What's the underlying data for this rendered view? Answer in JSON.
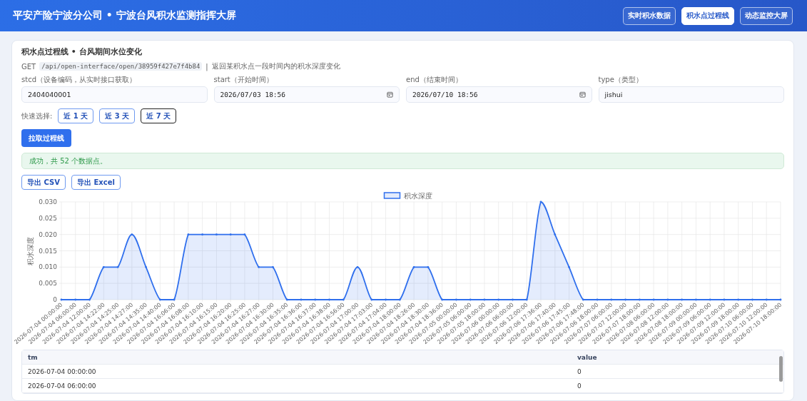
{
  "header": {
    "title": "平安产险宁波分公司 • 宁波台风积水监测指挥大屏",
    "nav": [
      {
        "label": "实时积水数据",
        "selected": false
      },
      {
        "label": "积水点过程线",
        "selected": true
      },
      {
        "label": "动态监控大屏",
        "selected": false
      }
    ]
  },
  "panel": {
    "title": "积水点过程线 • 台风期间水位变化",
    "api": {
      "method": "GET",
      "path": "/api/open-interface/open/38959f427e7f4b84",
      "separator": "|",
      "description": "返回某积水点一段时间内的积水深度变化"
    },
    "fields": [
      {
        "kind": "text",
        "label": "stcd（设备编码，从实时接口获取）",
        "value": "2404040001"
      },
      {
        "kind": "datetime",
        "label": "start（开始时间）",
        "value": "2026/07/03 18:56"
      },
      {
        "kind": "datetime",
        "label": "end（结束时间）",
        "value": "2026/07/10 18:56"
      },
      {
        "kind": "text",
        "label": "type（类型）",
        "value": "jishui"
      }
    ],
    "quick_select": {
      "label": "快速选择:",
      "options": [
        {
          "label": "近 1 天",
          "selected": false
        },
        {
          "label": "近 3 天",
          "selected": false
        },
        {
          "label": "近 7 天",
          "selected": true
        }
      ]
    },
    "fetch_button": "拉取过程线",
    "status": "成功，共 52 个数据点。",
    "export_buttons": [
      "导出 CSV",
      "导出 Excel"
    ],
    "chart_data": {
      "type": "area",
      "grid": true,
      "ylabel": "积水深度",
      "ylim": [
        0,
        0.03
      ],
      "yticks": [
        {
          "value": 0,
          "label": "0"
        },
        {
          "value": 0.005,
          "label": "0.005"
        },
        {
          "value": 0.01,
          "label": "0.010"
        },
        {
          "value": 0.015,
          "label": "0.015"
        },
        {
          "value": 0.02,
          "label": "0.020"
        },
        {
          "value": 0.025,
          "label": "0.025"
        },
        {
          "value": 0.03,
          "label": "0.030"
        }
      ],
      "categories": [
        "2026-07-04 00:00:00",
        "2026-07-04 06:00:00",
        "2026-07-04 12:00:00",
        "2026-07-04 14:22:00",
        "2026-07-04 14:25:00",
        "2026-07-04 14:27:00",
        "2026-07-04 14:35:00",
        "2026-07-04 14:40:00",
        "2026-07-04 16:06:00",
        "2026-07-04 16:08:00",
        "2026-07-04 16:10:00",
        "2026-07-04 16:15:00",
        "2026-07-04 16:20:00",
        "2026-07-04 16:25:00",
        "2026-07-04 16:27:00",
        "2026-07-04 16:30:00",
        "2026-07-04 16:35:00",
        "2026-07-04 16:36:00",
        "2026-07-04 16:37:00",
        "2026-07-04 16:38:00",
        "2026-07-04 16:56:00",
        "2026-07-04 17:00:00",
        "2026-07-04 17:03:00",
        "2026-07-04 17:04:00",
        "2026-07-04 18:00:00",
        "2026-07-04 18:26:00",
        "2026-07-04 18:30:00",
        "2026-07-04 18:36:00",
        "2026-07-05 00:00:00",
        "2026-07-05 06:00:00",
        "2026-07-05 18:00:00",
        "2026-07-06 00:00:00",
        "2026-07-06 06:00:00",
        "2026-07-06 12:00:00",
        "2026-07-06 17:36:00",
        "2026-07-06 17:40:00",
        "2026-07-06 17:45:00",
        "2026-07-06 17:48:00",
        "2026-07-06 18:00:00",
        "2026-07-07 06:00:00",
        "2026-07-07 12:00:00",
        "2026-07-07 18:00:00",
        "2026-07-08 06:00:00",
        "2026-07-08 12:00:00",
        "2026-07-08 18:00:00",
        "2026-07-09 00:00:00",
        "2026-07-09 06:00:00",
        "2026-07-09 12:00:00",
        "2026-07-09 18:00:00",
        "2026-07-10 06:00:00",
        "2026-07-10 12:00:00",
        "2026-07-10 18:00:00"
      ],
      "series": [
        {
          "name": "积水深度",
          "color": "#2f6fed",
          "values": [
            0,
            0,
            0,
            0.01,
            0.01,
            0.02,
            0.01,
            0,
            0,
            0.02,
            0.02,
            0.02,
            0.02,
            0.02,
            0.01,
            0.01,
            0,
            0,
            0,
            0,
            0,
            0.01,
            0,
            0,
            0,
            0.01,
            0.01,
            0,
            0,
            0,
            0,
            0,
            0,
            0,
            0.03,
            0.02,
            0.01,
            0,
            0,
            0,
            0,
            0,
            0,
            0,
            0,
            0,
            0,
            0,
            0,
            0,
            0,
            0
          ]
        }
      ]
    },
    "table": {
      "columns": [
        "tm",
        "value"
      ],
      "rows": [
        [
          "2026-07-04 00:00:00",
          "0"
        ],
        [
          "2026-07-04 06:00:00",
          "0"
        ]
      ]
    }
  }
}
